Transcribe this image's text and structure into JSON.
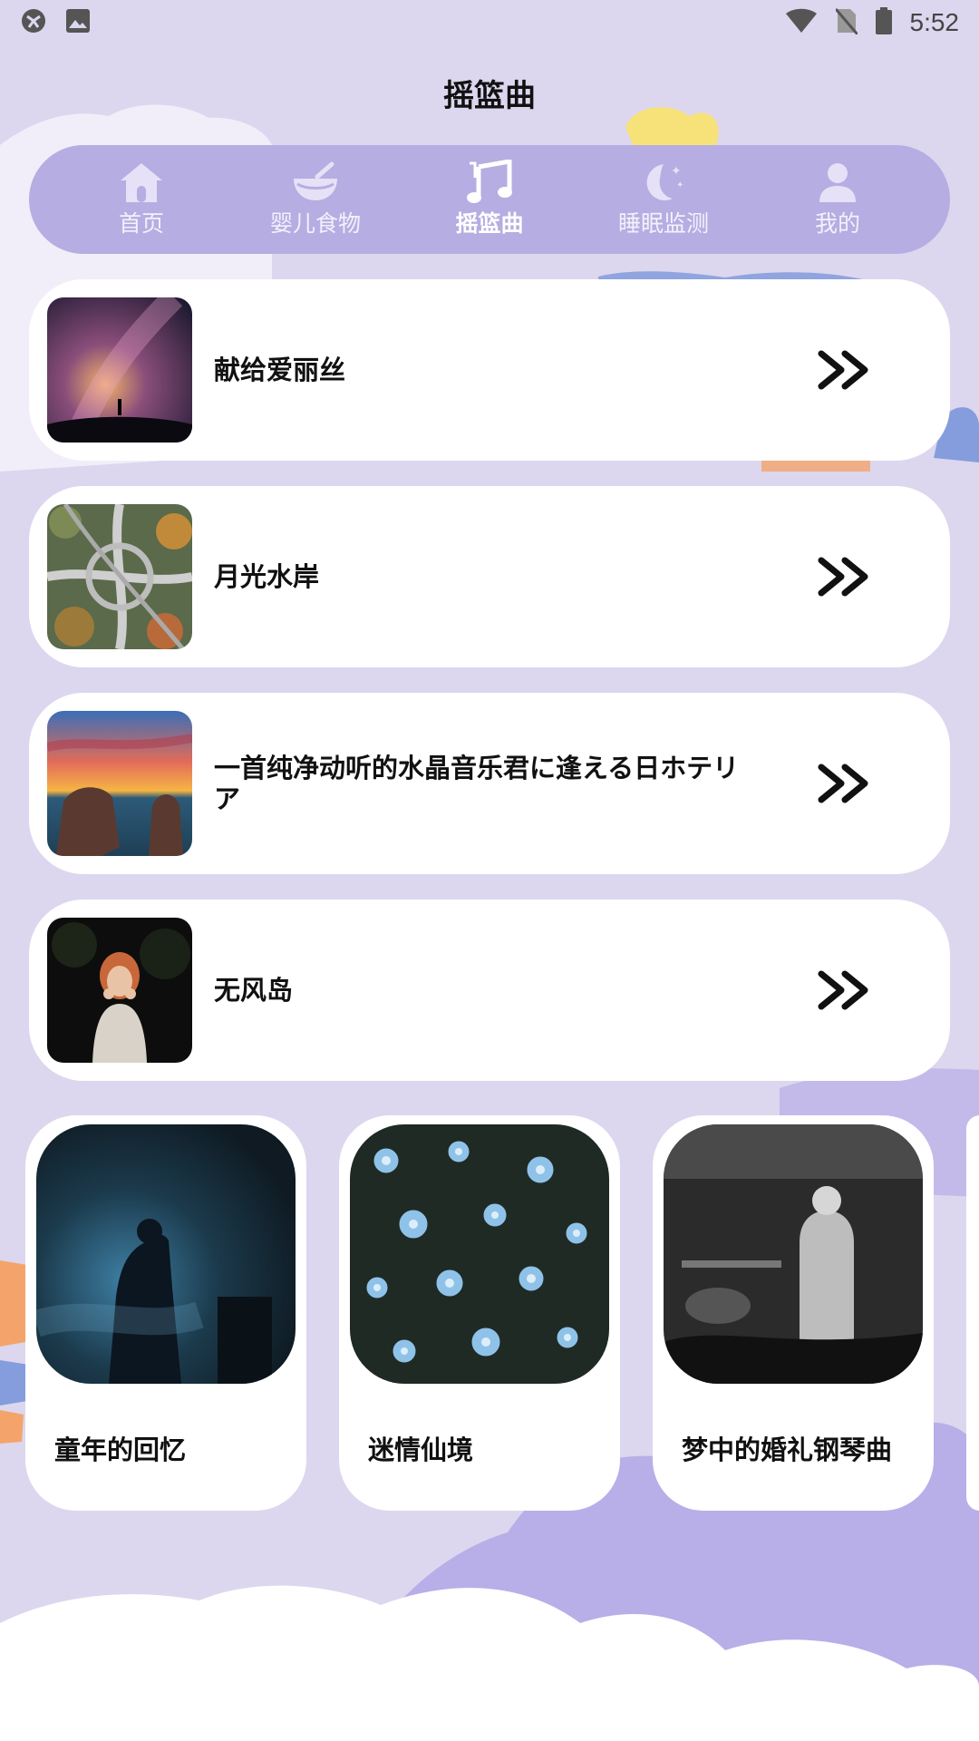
{
  "status_bar": {
    "time": "5:52",
    "left_icons": [
      "sync-icon",
      "image-icon"
    ],
    "right_icons": [
      "wifi-icon",
      "no-sim-icon",
      "battery-icon"
    ]
  },
  "page": {
    "title": "摇篮曲"
  },
  "tabs": [
    {
      "label": "首页",
      "icon": "home-icon",
      "active": false
    },
    {
      "label": "婴儿食物",
      "icon": "food-bowl-icon",
      "active": false
    },
    {
      "label": "摇篮曲",
      "icon": "music-note-icon",
      "active": true
    },
    {
      "label": "睡眠监测",
      "icon": "moon-icon",
      "active": false
    },
    {
      "label": "我的",
      "icon": "person-icon",
      "active": false
    }
  ],
  "songs": [
    {
      "title": "献给爱丽丝",
      "thumb": "milky-way-night-sky"
    },
    {
      "title": "月光水岸",
      "thumb": "highway-interchange-aerial"
    },
    {
      "title": "一首纯净动听的水晶音乐君に逢える日ホテリア",
      "thumb": "sea-rocks-sunset"
    },
    {
      "title": "无风岛",
      "thumb": "girl-in-dark"
    }
  ],
  "cards": [
    {
      "title": "童年的回忆",
      "image": "blue-smoke-performer"
    },
    {
      "title": "迷情仙境",
      "image": "blue-flowers"
    },
    {
      "title": "梦中的婚礼钢琴曲",
      "image": "concert-singer-bw"
    }
  ],
  "colors": {
    "background": "#dcd7ee",
    "tab_bar": "#b6ade2",
    "card": "#ffffff",
    "accent_purple": "#b8aee8"
  }
}
